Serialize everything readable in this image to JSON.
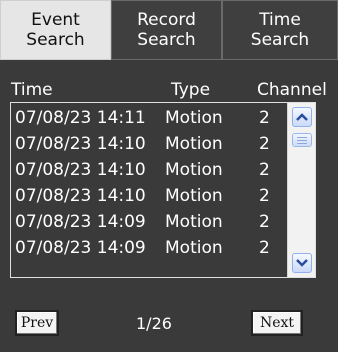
{
  "tabs": [
    {
      "line1": "Event",
      "line2": "Search",
      "active": true
    },
    {
      "line1": "Record",
      "line2": "Search",
      "active": false
    },
    {
      "line1": "Time",
      "line2": "Search",
      "active": false
    }
  ],
  "columns": {
    "time": "Time",
    "type": "Type",
    "channel": "Channel"
  },
  "events": [
    {
      "time": "07/08/23 14:11",
      "type": "Motion",
      "channel": "2"
    },
    {
      "time": "07/08/23 14:10",
      "type": "Motion",
      "channel": "2"
    },
    {
      "time": "07/08/23 14:10",
      "type": "Motion",
      "channel": "2"
    },
    {
      "time": "07/08/23 14:10",
      "type": "Motion",
      "channel": "2"
    },
    {
      "time": "07/08/23 14:09",
      "type": "Motion",
      "channel": "2"
    },
    {
      "time": "07/08/23 14:09",
      "type": "Motion",
      "channel": "2"
    }
  ],
  "pagination": {
    "prev_label": "Prev",
    "next_label": "Next",
    "page_text": "1/26"
  },
  "icons": {
    "scroll_up": "chevron-up-icon",
    "scroll_down": "chevron-down-icon"
  },
  "colors": {
    "background": "#3a3a3a",
    "active_tab": "#e6e6e6",
    "scroll_arrow": "#2a4da0"
  }
}
